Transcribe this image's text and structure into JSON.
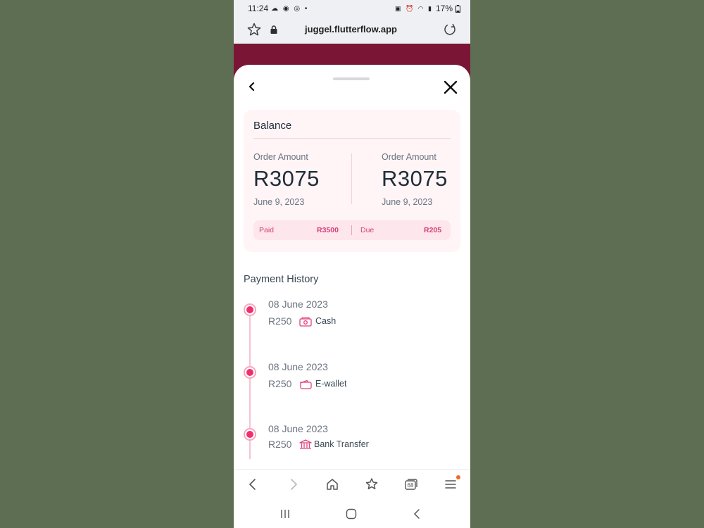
{
  "status_bar": {
    "time": "11:24",
    "battery": "17%",
    "icons": [
      "cloud-icon",
      "messenger-icon",
      "instagram-icon",
      "dot-icon",
      "sim-icon",
      "alarm-icon",
      "wifi-icon",
      "volte-icon",
      "signal-icon",
      "battery-icon"
    ]
  },
  "browser": {
    "url": "juggel.flutterflow.app"
  },
  "sheet": {
    "balance": {
      "title": "Balance",
      "left": {
        "label": "Order Amount",
        "value": "R3075",
        "date": "June 9, 2023"
      },
      "right": {
        "label": "Order Amount",
        "value": "R3075",
        "date": "June 9, 2023"
      },
      "paid_label": "Paid",
      "paid_value": "R3500",
      "due_label": "Due",
      "due_value": "R205"
    },
    "history_title": "Payment History",
    "history": [
      {
        "date": "08 June 2023",
        "amount": "R250",
        "method": "Cash",
        "icon": "cash-icon"
      },
      {
        "date": "08 June 2023",
        "amount": "R250",
        "method": "E-wallet",
        "icon": "wallet-icon"
      },
      {
        "date": "08 June 2023",
        "amount": "R250",
        "method": "Bank Transfer",
        "icon": "bank-icon"
      }
    ]
  },
  "navbar": {
    "tabs_count": "68"
  },
  "colors": {
    "accent": "#ef2f6c",
    "header_bg": "#7a1535",
    "card_bg": "#fff4f6",
    "page_bg": "#5e6e52"
  }
}
